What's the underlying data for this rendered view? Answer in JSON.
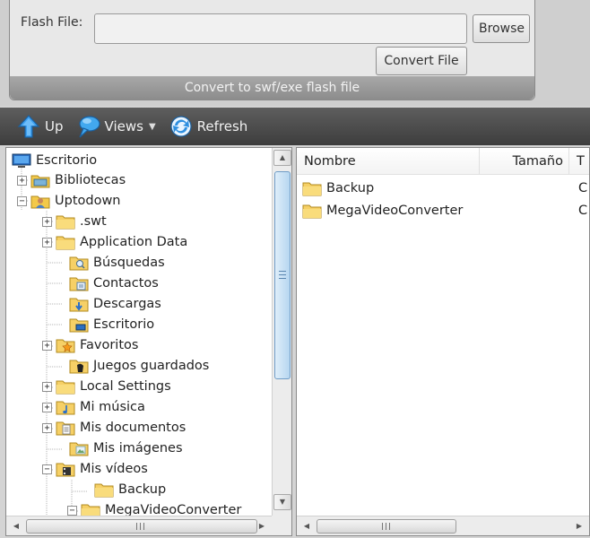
{
  "convert_panel": {
    "flash_file_label": "Flash File:",
    "flash_file_value": "",
    "browse_label": "Browse",
    "convert_label": "Convert File",
    "footer_text": "Convert to swf/exe flash file"
  },
  "toolbar": {
    "up_label": "Up",
    "views_label": "Views",
    "refresh_label": "Refresh"
  },
  "tree": {
    "root_label": "Escritorio",
    "items": [
      {
        "label": "Bibliotecas",
        "icon": "library-icon"
      },
      {
        "label": "Uptodown",
        "icon": "user-folder-icon"
      },
      {
        "label": ".swt",
        "icon": "folder-icon"
      },
      {
        "label": "Application Data",
        "icon": "folder-icon"
      },
      {
        "label": "Búsquedas",
        "icon": "search-folder-icon"
      },
      {
        "label": "Contactos",
        "icon": "contacts-folder-icon"
      },
      {
        "label": "Descargas",
        "icon": "downloads-folder-icon"
      },
      {
        "label": "Escritorio",
        "icon": "desktop-folder-icon"
      },
      {
        "label": "Favoritos",
        "icon": "favorites-folder-icon"
      },
      {
        "label": "Juegos guardados",
        "icon": "games-folder-icon"
      },
      {
        "label": "Local Settings",
        "icon": "folder-icon"
      },
      {
        "label": "Mi música",
        "icon": "music-folder-icon"
      },
      {
        "label": "Mis documentos",
        "icon": "documents-folder-icon"
      },
      {
        "label": "Mis imágenes",
        "icon": "pictures-folder-icon"
      },
      {
        "label": "Mis vídeos",
        "icon": "videos-folder-icon"
      },
      {
        "label": "Backup",
        "icon": "folder-icon"
      },
      {
        "label": "MegaVideoConverter",
        "icon": "folder-icon"
      }
    ]
  },
  "file_list": {
    "columns": [
      "Nombre",
      "Tamaño",
      "T"
    ],
    "rows": [
      {
        "name": "Backup",
        "type": "C"
      },
      {
        "name": "MegaVideoConverter",
        "type": "C"
      }
    ]
  },
  "colors": {
    "toolbar_bg": "#4a4a4a",
    "folder_yellow": "#f3c94a",
    "scroll_thumb_blue": "#b6d6f0"
  }
}
